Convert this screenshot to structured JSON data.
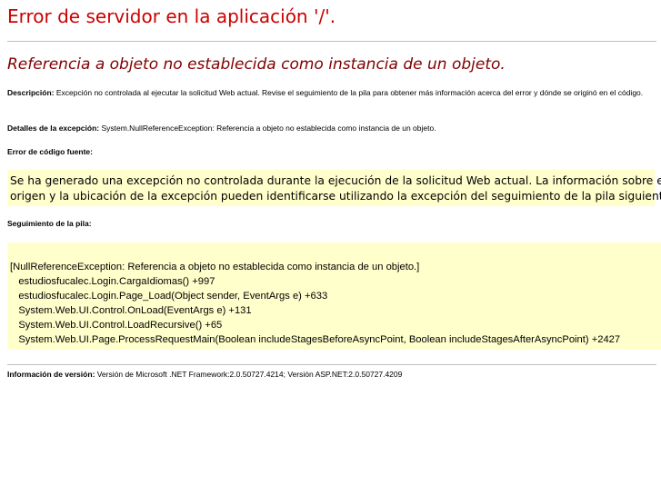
{
  "title": "Error de servidor en la aplicación '/'.",
  "subtitle": "Referencia a objeto no establecida como instancia de un objeto.",
  "description": {
    "label": "Descripción:",
    "text": "Excepción no controlada al ejecutar la solicitud Web actual. Revise el seguimiento de la pila para obtener más información acerca del error y dónde se originó en el código."
  },
  "exception_details": {
    "label": "Detalles de la excepción:",
    "text": "System.NullReferenceException: Referencia a objeto no establecida como instancia de un objeto."
  },
  "source_error": {
    "label": "Error de código fuente:",
    "lines": [
      "Se ha generado una excepción no controlada durante la ejecución de la solicitud Web actual. La información sobre el",
      "origen y la ubicación de la excepción pueden identificarse utilizando la excepción del seguimiento de la pila siguiente."
    ]
  },
  "stack_trace": {
    "label": "Seguimiento de la pila:",
    "lines": [
      "[NullReferenceException: Referencia a objeto no establecida como instancia de un objeto.]",
      "   estudiosfucalec.Login.CargaIdiomas() +997",
      "   estudiosfucalec.Login.Page_Load(Object sender, EventArgs e) +633",
      "   System.Web.UI.Control.OnLoad(EventArgs e) +131",
      "   System.Web.UI.Control.LoadRecursive() +65",
      "   System.Web.UI.Page.ProcessRequestMain(Boolean includeStagesBeforeAsyncPoint, Boolean includeStagesAfterAsyncPoint) +2427"
    ]
  },
  "version_info": {
    "label": "Información de versión:",
    "text": "Versión de Microsoft .NET Framework:2.0.50727.4214; Versión ASP.NET:2.0.50727.4209"
  },
  "colors": {
    "title": "#cc0000",
    "subtitle": "#800000",
    "code_background": "#ffffcc",
    "rule": "#c0c0c0"
  }
}
